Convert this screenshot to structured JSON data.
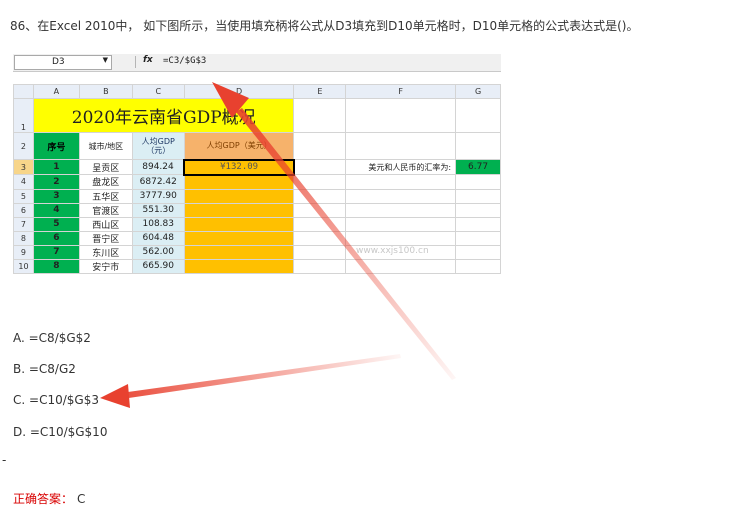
{
  "question": "86、在Excel 2010中， 如下图所示，当使用填充柄将公式从D3填充到D10单元格时，D10单元格的公式表达式是()。",
  "excel": {
    "name_box": "D3",
    "fx": "fx",
    "formula": "=C3/$G$3",
    "col_headers": [
      "A",
      "B",
      "C",
      "D",
      "E",
      "F",
      "G"
    ],
    "title": "2020年云南省GDP概况",
    "headers": {
      "no": "序号",
      "city": "城市/地区",
      "gdp_cny": "人均GDP（元）",
      "gdp_usd": "人均GDP（美元）"
    },
    "rows": [
      {
        "row": "3",
        "no": "1",
        "city": "呈贡区",
        "gdp": "894.24",
        "usd": "¥132.09"
      },
      {
        "row": "4",
        "no": "2",
        "city": "盘龙区",
        "gdp": "6872.42",
        "usd": ""
      },
      {
        "row": "5",
        "no": "3",
        "city": "五华区",
        "gdp": "3777.90",
        "usd": ""
      },
      {
        "row": "6",
        "no": "4",
        "city": "官渡区",
        "gdp": "551.30",
        "usd": ""
      },
      {
        "row": "7",
        "no": "5",
        "city": "西山区",
        "gdp": "108.83",
        "usd": ""
      },
      {
        "row": "8",
        "no": "6",
        "city": "晋宁区",
        "gdp": "604.48",
        "usd": ""
      },
      {
        "row": "9",
        "no": "7",
        "city": "东川区",
        "gdp": "562.00",
        "usd": ""
      },
      {
        "row": "10",
        "no": "8",
        "city": "安宁市",
        "gdp": "665.90",
        "usd": ""
      }
    ],
    "row_labels": [
      "1",
      "2"
    ],
    "rate_label": "美元和人民币的汇率为:",
    "rate_value": "6.77",
    "watermark": "www.xxjs100.cn"
  },
  "options": [
    "A. =C8/$G$2",
    "B. =C8/G2",
    "C. =C10/$G$3",
    "D. =C10/$G$10"
  ],
  "dash": "-",
  "answer_label": "正确答案：",
  "answer_value": "C",
  "colors": {
    "title_fill": "#ffff00",
    "green_fill": "#00b050",
    "orange_fill": "#ffc000",
    "arrow": "#e8412f",
    "answer_label": "#d80000"
  }
}
